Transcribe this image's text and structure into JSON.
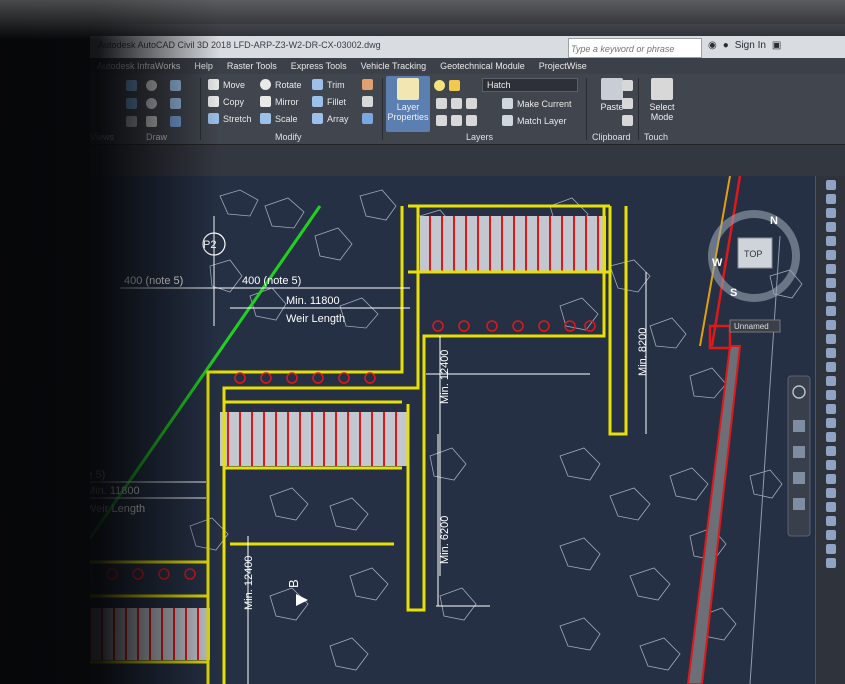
{
  "window": {
    "title": "Autodesk AutoCAD Civil 3D 2018   LFD-ARP-Z3-W2-DR-CX-03002.dwg",
    "search_placeholder": "Type a keyword or phrase",
    "sign_in": "Sign In"
  },
  "menubar": {
    "items": [
      "Autodesk InfraWorks",
      "Help",
      "Raster Tools",
      "Express Tools",
      "Vehicle Tracking",
      "Geotechnical Module",
      "ProjectWise"
    ]
  },
  "ribbon": {
    "panels": {
      "views": "Views",
      "draw": "Draw",
      "modify": "Modify",
      "layers": "Layers",
      "clipboard": "Clipboard",
      "touch": "Touch"
    },
    "modify_tools": [
      "Move",
      "Rotate",
      "Trim",
      "Copy",
      "Mirror",
      "Fillet",
      "Stretch",
      "Scale",
      "Array"
    ],
    "layer_properties": "Layer Properties",
    "hatch_layer": "Hatch",
    "make_current": "Make Current",
    "match_layer": "Match Layer",
    "paste": "Paste",
    "select_mode": "Select Mode"
  },
  "drawing": {
    "labels": {
      "p2": "P2",
      "dim_400_top_left": "400 (note 5)",
      "dim_400_top_right": "400 (note 5)",
      "min_11800_top": "Min. 11800",
      "weir_length_top": "Weir Length",
      "dim_400_lower": "400 (note 5)",
      "min_11800_lower": "Min. 11800",
      "weir_length_lower": "Weir Length",
      "min_12400_center": "Min. 12400",
      "min_8200": "Min. 8200",
      "min_6200": "Min. 6200",
      "min_12400_left": "Min. 12400",
      "section_b": "B"
    }
  },
  "viewcube": {
    "face": "TOP",
    "compass": [
      "N",
      "W",
      "S"
    ],
    "wcs": "Unnamed"
  },
  "colors": {
    "canvas": "#253044",
    "weir_outline": "#e8e000",
    "rebar_red": "#e01818",
    "section_line": "#1fd21f"
  }
}
